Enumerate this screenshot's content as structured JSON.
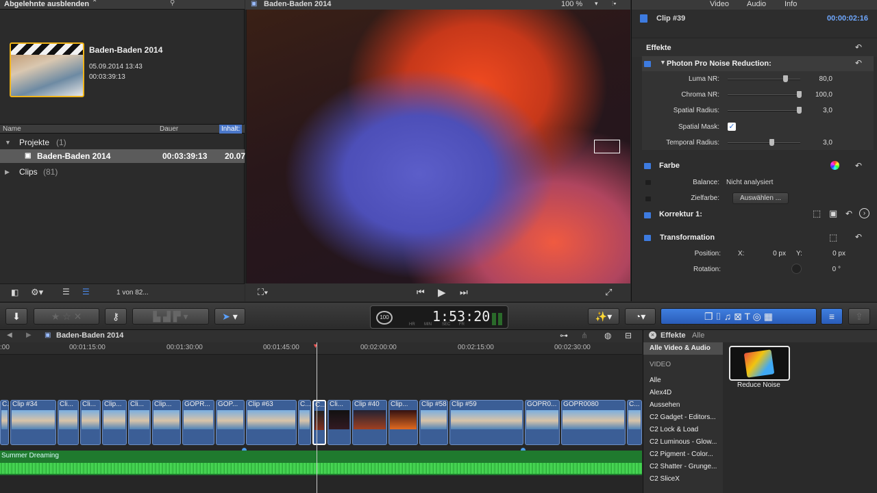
{
  "library": {
    "filter_label": "Abgelehnte ausblenden",
    "event": {
      "name": "Baden-Baden 2014",
      "date": "05.09.2014 13:43",
      "duration": "00:03:39:13"
    },
    "columns": {
      "name": "Name",
      "duration": "Dauer",
      "content": "Inhalt:"
    },
    "rows": [
      {
        "label": "Projekte",
        "count": "(1)"
      },
      {
        "label": "Baden-Baden 2014",
        "duration": "00:03:39:13",
        "content": "20.07"
      },
      {
        "label": "Clips",
        "count": "(81)"
      }
    ],
    "selection_count": "1 von 82..."
  },
  "viewer": {
    "title": "Baden-Baden 2014",
    "zoom": "100 %"
  },
  "inspector": {
    "tabs": [
      "Video",
      "Audio",
      "Info"
    ],
    "clip_name": "Clip #39",
    "clip_duration": "00:00:02:16",
    "effects_title": "Effekte",
    "noise_reduction": {
      "title": "Photon Pro Noise Reduction:",
      "params": [
        {
          "label": "Luma NR:",
          "value": "80,0",
          "level": 0.8
        },
        {
          "label": "Chroma NR:",
          "value": "100,0",
          "level": 1.0
        },
        {
          "label": "Spatial Radius:",
          "value": "3,0",
          "level": 1.0
        },
        {
          "label": "Spatial Mask:",
          "checked": true
        },
        {
          "label": "Temporal Radius:",
          "value": "3,0",
          "level": 0.6
        }
      ]
    },
    "color": {
      "title": "Farbe",
      "balance_label": "Balance:",
      "balance_value": "Nicht analysiert",
      "target_label": "Zielfarbe:",
      "target_button": "Auswählen ..."
    },
    "correction": {
      "title": "Korrektur 1:"
    },
    "transform": {
      "title": "Transformation",
      "position_label": "Position:",
      "x_label": "X:",
      "x_value": "0 px",
      "y_label": "Y:",
      "y_value": "0 px",
      "rotation_label": "Rotation:",
      "rotation_value": "0 °"
    }
  },
  "toolbar": {
    "timecode": "1:53:20",
    "timecode_small": "100",
    "timecode_units": [
      "HR",
      "MIN",
      "SEC",
      "FR"
    ]
  },
  "timeline": {
    "title": "Baden-Baden 2014",
    "ruler": [
      ":00",
      "00:01:15:00",
      "00:01:30:00",
      "00:01:45:00",
      "00:02:00:00",
      "00:02:15:00",
      "00:02:30:00"
    ],
    "clips": [
      "C.",
      "Clip #34",
      "Cli...",
      "Cli...",
      "Clip...",
      "Cli...",
      "Clip...",
      "GOPR...",
      "GOP...",
      "Clip #63",
      "C...",
      "C...",
      "Cli...",
      "Clip #40",
      "Clip...",
      "Clip #58",
      "Clip #59",
      "GOPR0...",
      "GOPR0080",
      "C..."
    ],
    "audio_label": "Summer Dreaming"
  },
  "effects_browser": {
    "title": "Effekte",
    "scope": "Alle",
    "selected": "Alle Video & Audio",
    "section": "VIDEO",
    "categories": [
      "Alle",
      "Alex4D",
      "Aussehen",
      "C2 Gadget - Editors...",
      "C2 Lock & Load",
      "C2 Luminous - Glow...",
      "C2 Pigment - Color...",
      "C2 Shatter - Grunge...",
      "C2 SliceX"
    ],
    "effect_name": "Reduce Noise"
  },
  "colors": {
    "accent": "#3d7be0",
    "event_border": "#f0b419",
    "audio": "#1f7a2e"
  }
}
